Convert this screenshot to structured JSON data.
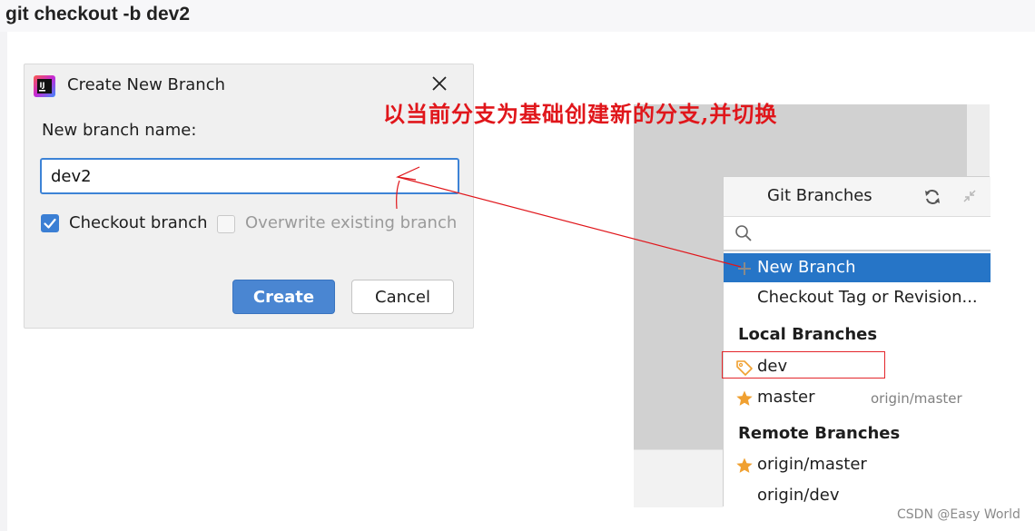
{
  "heading": "git checkout -b  dev2",
  "dialog": {
    "title": "Create New Branch",
    "label": "New branch name:",
    "input_value": "dev2",
    "checkout_label": "Checkout branch",
    "overwrite_label": "Overwrite existing branch",
    "create_label": "Create",
    "cancel_label": "Cancel"
  },
  "annotation": "以当前分支为基础创建新的分支,并切换",
  "popup": {
    "title": "Git Branches",
    "new_branch": "New Branch",
    "checkout_tag": "Checkout Tag or Revision...",
    "local_heading": "Local Branches",
    "local": [
      {
        "name": "dev",
        "tracking": ""
      },
      {
        "name": "master",
        "tracking": "origin/master"
      }
    ],
    "remote_heading": "Remote Branches",
    "remote": [
      {
        "name": "origin/master"
      },
      {
        "name": "origin/dev"
      }
    ]
  },
  "watermark": "CSDN @Easy World",
  "colors": {
    "selection": "#2675c7",
    "accent_button": "#4a86d2",
    "annotation_red": "#e0161b",
    "star": "#f0a030"
  }
}
